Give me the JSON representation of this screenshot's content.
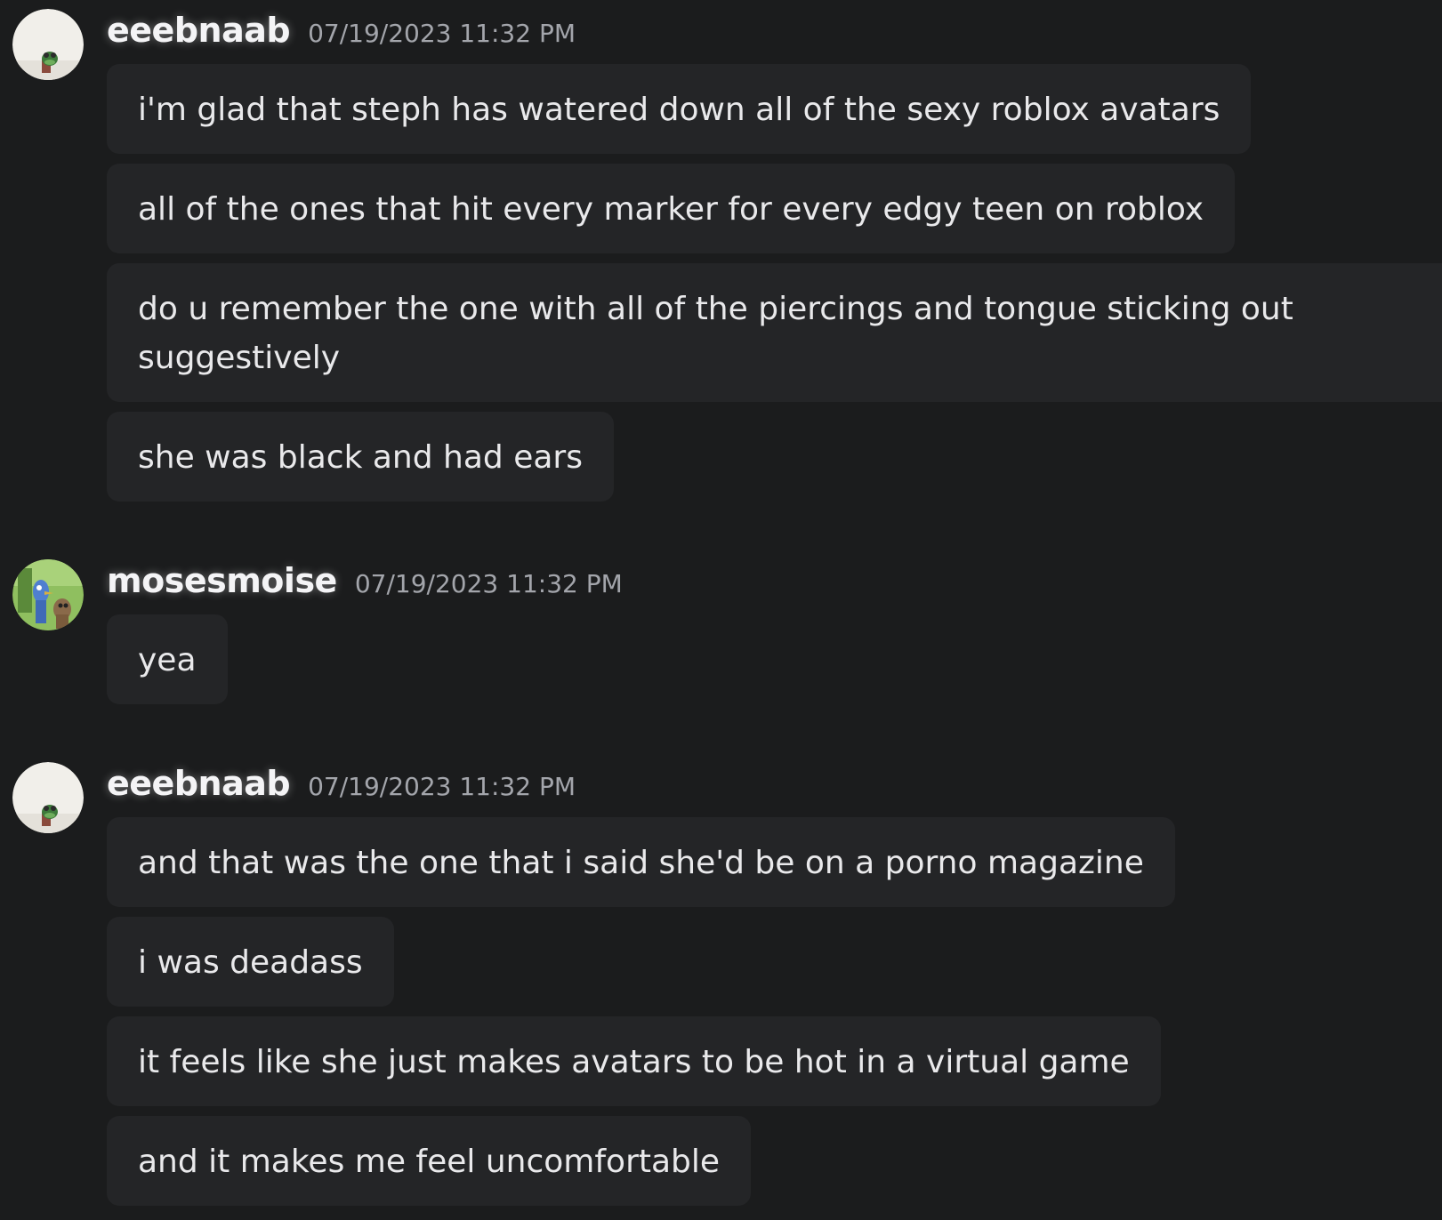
{
  "groups": [
    {
      "username": "eeebnaab",
      "timestamp": "07/19/2023 11:32 PM",
      "avatar_icon": "frog-avatar-icon",
      "messages": [
        "i'm glad that steph has watered down all of the sexy roblox avatars",
        "all of the ones that hit every marker for every edgy teen on roblox",
        "do u remember the one with all of the piercings and tongue sticking out suggestively",
        "she was black and had ears"
      ]
    },
    {
      "username": "mosesmoise",
      "timestamp": "07/19/2023 11:32 PM",
      "avatar_icon": "cartoon-avatar-icon",
      "messages": [
        "yea"
      ]
    },
    {
      "username": "eeebnaab",
      "timestamp": "07/19/2023 11:32 PM",
      "avatar_icon": "frog-avatar-icon",
      "messages": [
        "and that was the one that i said she'd be on a porno magazine",
        "i was deadass",
        "it feels like she just makes avatars to be hot in a virtual game",
        "and it makes me feel uncomfortable"
      ]
    }
  ],
  "colors": {
    "background": "#1b1c1d",
    "bubble": "#242527",
    "username": "#f4f4f6",
    "timestamp": "#a3a5ab"
  }
}
